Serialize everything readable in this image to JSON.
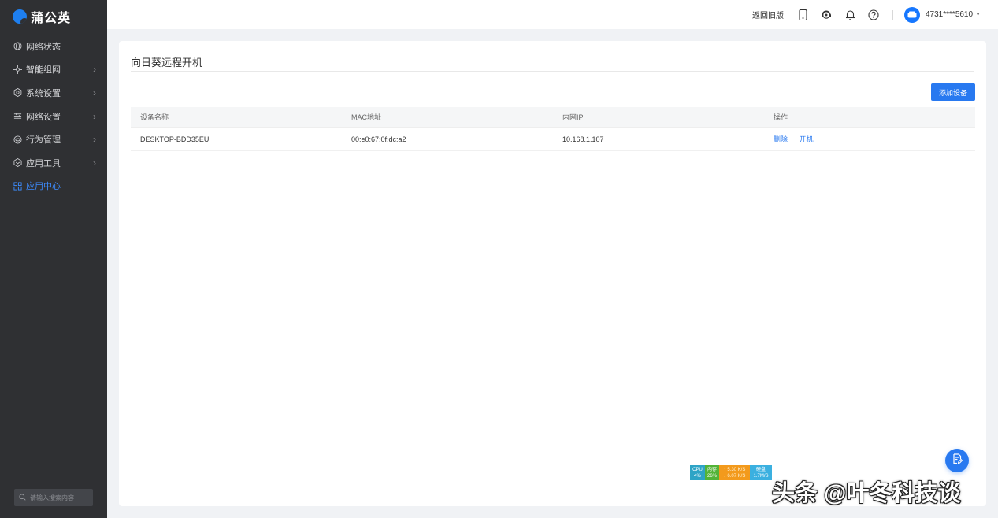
{
  "sidebar": {
    "logo_text": "蒲公英",
    "items": [
      {
        "label": "网络状态",
        "icon": "globe-icon",
        "has_children": false,
        "active": false
      },
      {
        "label": "智能组网",
        "icon": "network-icon",
        "has_children": true,
        "active": false
      },
      {
        "label": "系统设置",
        "icon": "gear-icon",
        "has_children": true,
        "active": false
      },
      {
        "label": "网络设置",
        "icon": "sliders-icon",
        "has_children": true,
        "active": false
      },
      {
        "label": "行为管理",
        "icon": "behavior-icon",
        "has_children": true,
        "active": false
      },
      {
        "label": "应用工具",
        "icon": "tool-icon",
        "has_children": true,
        "active": false
      },
      {
        "label": "应用中心",
        "icon": "grid-icon",
        "has_children": false,
        "active": true
      }
    ],
    "search_placeholder": "请输入搜索内容"
  },
  "header": {
    "old_version_link": "返回旧版",
    "account": "4731****5610"
  },
  "page": {
    "title": "向日葵远程开机",
    "add_button": "添加设备",
    "table": {
      "headers": [
        "设备名称",
        "MAC地址",
        "内网IP",
        "操作"
      ],
      "rows": [
        {
          "name": "DESKTOP-BDD35EU",
          "mac": "00:e0:67:0f:dc:a2",
          "ip": "10.168.1.107",
          "actions": [
            "删除",
            "开机"
          ]
        }
      ]
    }
  },
  "monitor_widget": {
    "cpu_label": "CPU",
    "cpu_value": "4%",
    "mem_label": "内存",
    "mem_value": "26%",
    "upload": "5.30 K/S",
    "download": "6.07 K/S",
    "disk_label": "硬盘",
    "disk_value": "1.7M/S"
  },
  "watermark": "头条 @叶冬科技谈",
  "colors": {
    "sidebar_bg": "#2f3033",
    "accent": "#2879f0",
    "active_nav": "#3d8cff",
    "page_bg": "#f0f2f5"
  }
}
